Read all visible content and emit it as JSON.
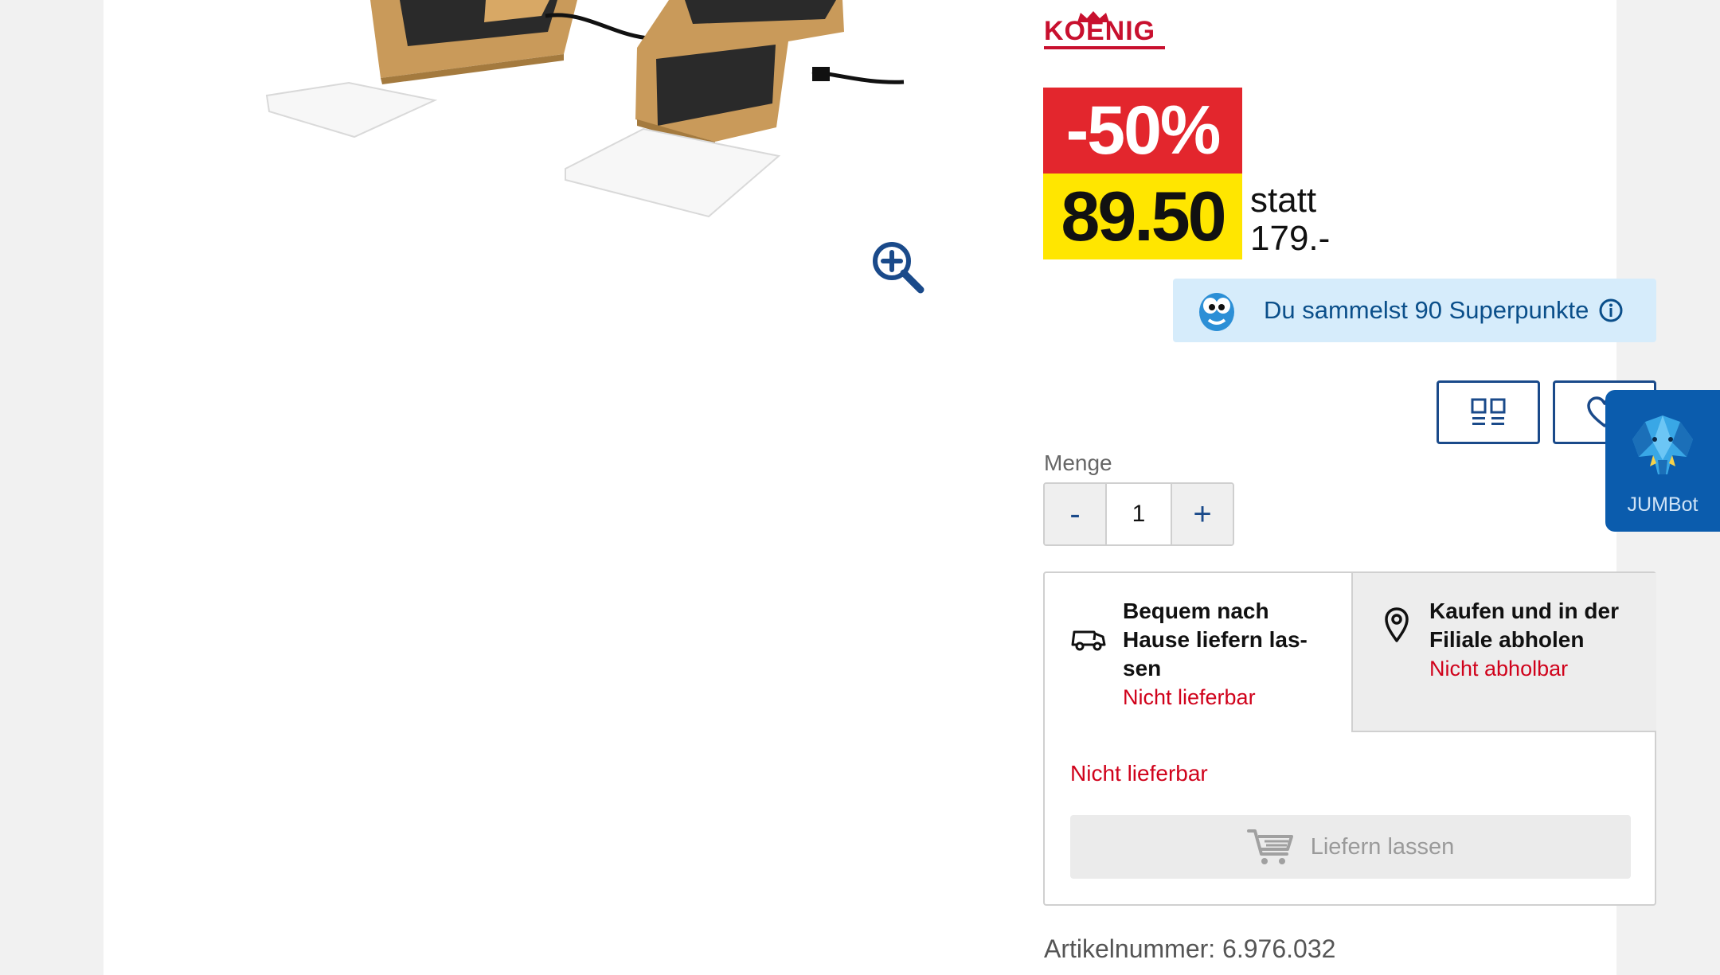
{
  "brand": {
    "name": "KOENIG"
  },
  "price": {
    "discount": "-50%",
    "current": "89.50",
    "old_prefix": "statt",
    "old_value": "179.-"
  },
  "superpunkte": {
    "text": "Du sammelst 90 Superpunkte"
  },
  "quantity": {
    "label": "Menge",
    "value": "1",
    "minus": "-",
    "plus": "+"
  },
  "delivery": {
    "home": {
      "title": "Bequem nach Hause liefern las-sen",
      "title_lines": [
        "Bequem nach",
        "Hause liefern las-",
        "sen"
      ],
      "status": "Nicht lieferbar"
    },
    "store": {
      "title_lines": [
        "Kaufen und in der",
        "Filiale abholen"
      ],
      "status": "Nicht abholbar"
    },
    "box_status": "Nicht lieferbar",
    "cart_button": "Liefern lassen"
  },
  "article": {
    "text": "Artikelnummer: 6.976.032"
  },
  "jumbot": {
    "label": "JUMBot"
  },
  "colors": {
    "discount_red": "#e3262d",
    "price_yellow": "#ffe600",
    "accent_blue": "#1a4a8a",
    "status_red": "#d0021b",
    "jumbot_blue": "#0b5cad"
  },
  "icons": [
    "zoom-in-icon",
    "mascot-icon",
    "info-icon",
    "compare-icon",
    "heart-icon",
    "delivery-van-icon",
    "location-pin-icon",
    "cart-icon",
    "jumbot-elephant-icon"
  ]
}
